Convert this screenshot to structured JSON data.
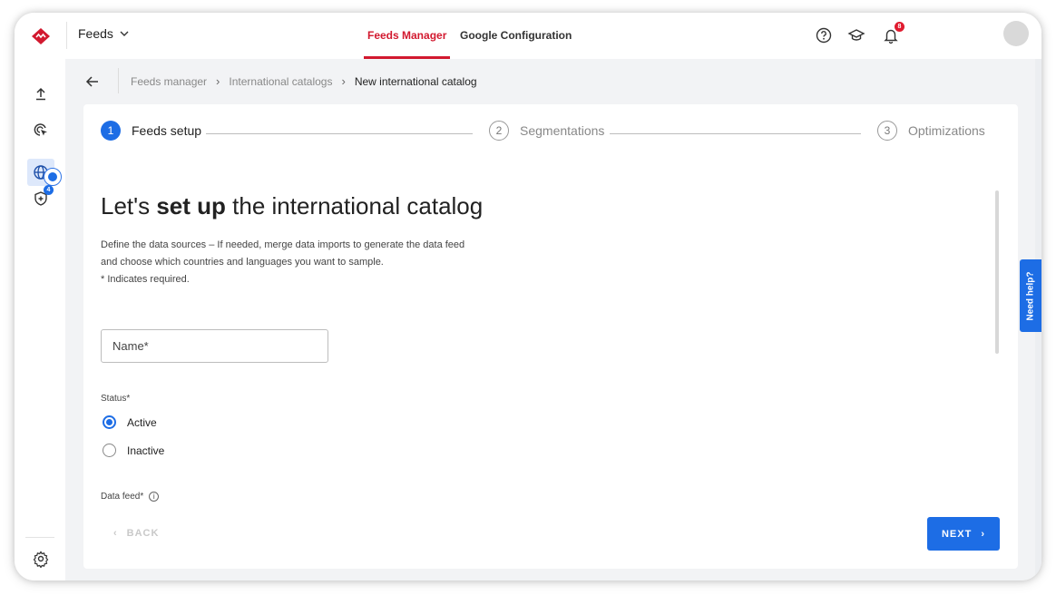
{
  "header": {
    "app_selector": "Feeds",
    "tabs": [
      {
        "label": "Feeds Manager",
        "active": true
      },
      {
        "label": "Google Configuration",
        "active": false
      }
    ],
    "notification_count": "8",
    "icons": [
      "help-icon",
      "academy-icon",
      "bell-icon"
    ]
  },
  "sidebar": {
    "items": [
      "upload-icon",
      "target-icon",
      "globe-icon",
      "shield-plus-icon",
      "settings-icon"
    ],
    "badge_count": "4"
  },
  "breadcrumb": {
    "items": [
      "Feeds manager",
      "International catalogs"
    ],
    "current": "New international catalog"
  },
  "stepper": {
    "steps": [
      {
        "number": "1",
        "label": "Feeds setup",
        "state": "active"
      },
      {
        "number": "2",
        "label": "Segmentations",
        "state": "inactive"
      },
      {
        "number": "3",
        "label": "Optimizations",
        "state": "inactive"
      }
    ]
  },
  "form": {
    "title_prefix": "Let's ",
    "title_bold": "set up",
    "title_suffix": " the international catalog",
    "description_line1": "Define the data sources – If needed, merge data imports to generate the data feed",
    "description_line2": "and choose which countries and languages you want to sample.",
    "description_line3": "* Indicates required.",
    "name_placeholder": "Name*",
    "name_value": "",
    "status_label": "Status*",
    "status_options": [
      {
        "label": "Active",
        "checked": true
      },
      {
        "label": "Inactive",
        "checked": false
      }
    ],
    "data_feed_label": "Data feed*",
    "data_feed_info": "i"
  },
  "actions": {
    "back_label": "BACK",
    "next_label": "NEXT"
  },
  "help_tab": "Need help?",
  "colors": {
    "brand_red": "#d2192f",
    "accent_blue": "#1d6de5",
    "content_bg": "#f2f3f5"
  }
}
